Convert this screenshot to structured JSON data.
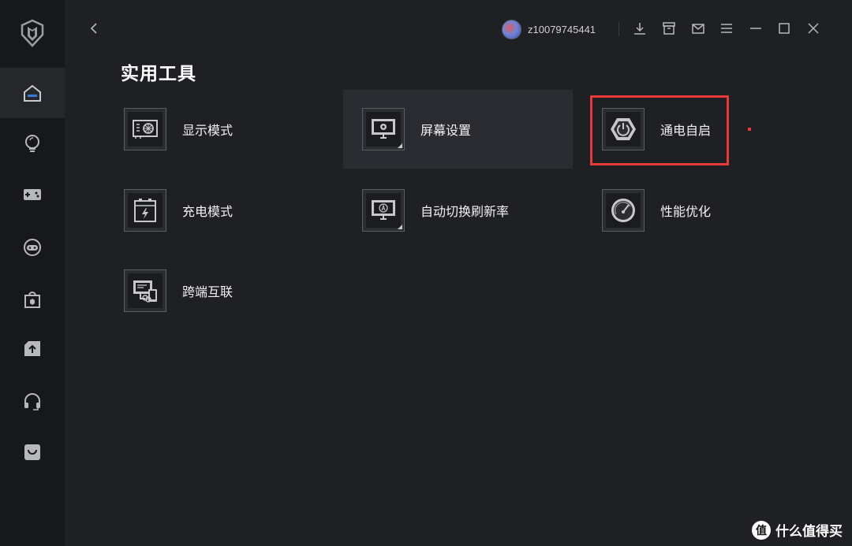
{
  "user": {
    "name": "z10079745441"
  },
  "page": {
    "title": "实用工具"
  },
  "tools": [
    {
      "label": "显示模式"
    },
    {
      "label": "屏幕设置"
    },
    {
      "label": "通电自启"
    },
    {
      "label": "充电模式"
    },
    {
      "label": "自动切换刷新率"
    },
    {
      "label": "性能优化"
    },
    {
      "label": "跨端互联"
    }
  ],
  "sidebar": {
    "items": [
      {
        "icon": "home-icon",
        "active": true
      },
      {
        "icon": "lightbulb-icon"
      },
      {
        "icon": "gamepad-icon"
      },
      {
        "icon": "chat-icon"
      },
      {
        "icon": "store-icon"
      },
      {
        "icon": "upload-icon"
      },
      {
        "icon": "headset-icon"
      },
      {
        "icon": "shopping-bag-icon"
      }
    ]
  },
  "titlebar_icons": [
    "back-icon",
    "download-icon",
    "package-icon",
    "mail-icon",
    "menu-icon",
    "minimize-icon",
    "maximize-icon",
    "close-icon"
  ],
  "watermark": {
    "mark": "值",
    "text": "什么值得买"
  },
  "colors": {
    "accent": "#3a7bd5",
    "highlight": "#e83a3a",
    "background": "#1f2024",
    "sidebar": "#17181b"
  }
}
